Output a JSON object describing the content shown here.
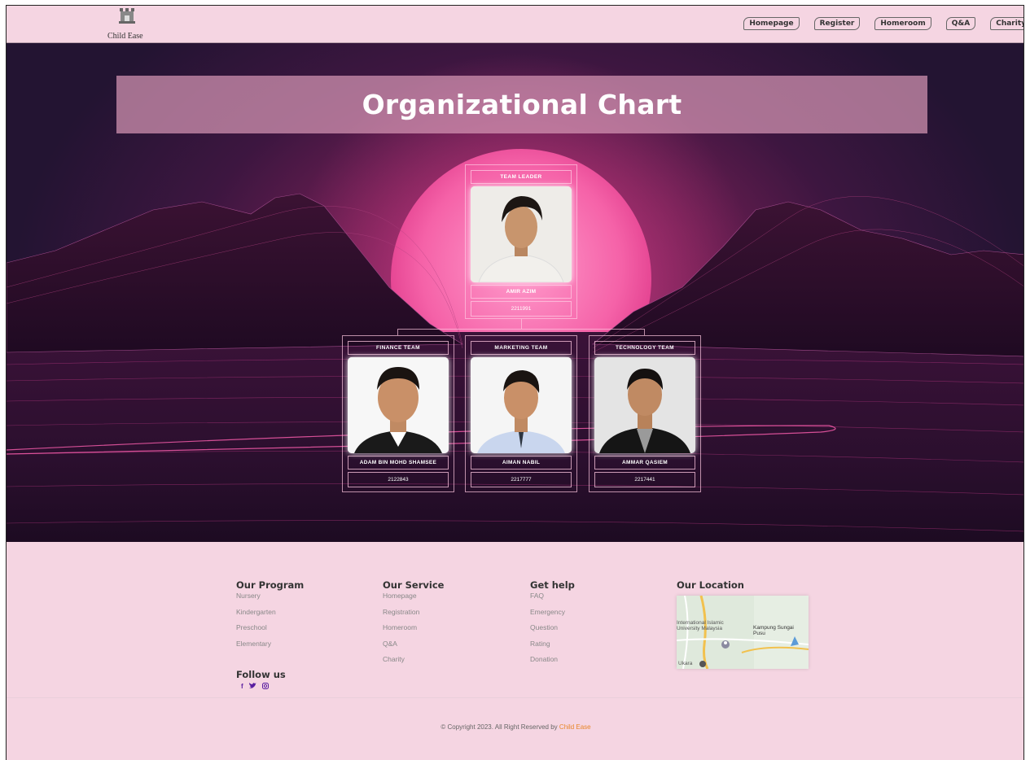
{
  "header": {
    "logo_text": "Child Ease",
    "nav": [
      "Homepage",
      "Register",
      "Homeroom",
      "Q&A",
      "Charity"
    ]
  },
  "hero": {
    "title": "Organizational Chart",
    "leader": {
      "role": "TEAM LEADER",
      "name": "AMIR AZIM",
      "id": "2211991"
    },
    "teams": [
      {
        "role": "FINANCE TEAM",
        "name": "ADAM BIN MOHD SHAMSEE",
        "id": "2122843"
      },
      {
        "role": "MARKETING TEAM",
        "name": "AIMAN NABIL",
        "id": "2217777"
      },
      {
        "role": "TECHNOLOGY TEAM",
        "name": "AMMAR QASIEM",
        "id": "2217441"
      }
    ]
  },
  "footer": {
    "program": {
      "title": "Our Program",
      "links": [
        "Nursery",
        "Kindergarten",
        "Preschool",
        "Elementary"
      ]
    },
    "service": {
      "title": "Our Service",
      "links": [
        "Homepage",
        "Registration",
        "Homeroom",
        "Q&A",
        "Charity"
      ]
    },
    "help": {
      "title": "Get help",
      "links": [
        "FAQ",
        "Emergency",
        "Question",
        "Rating",
        "Donation"
      ]
    },
    "location": {
      "title": "Our Location",
      "map_label_1": "International Islamic University Malaysia",
      "map_label_2": "Kampung Sungai Pusu",
      "map_label_3": "Ukara"
    },
    "follow": {
      "title": "Follow us",
      "icons": [
        "facebook-icon",
        "twitter-icon",
        "instagram-icon"
      ]
    },
    "copyright_prefix": "© Copyright 2023. All Right Reserved by",
    "copyright_brand": "Child Ease"
  },
  "colors": {
    "header_bg": "#f5d5e2",
    "title_band": "#d696b4",
    "brand_accent": "#e8872a",
    "social": "#5a1fa0"
  }
}
